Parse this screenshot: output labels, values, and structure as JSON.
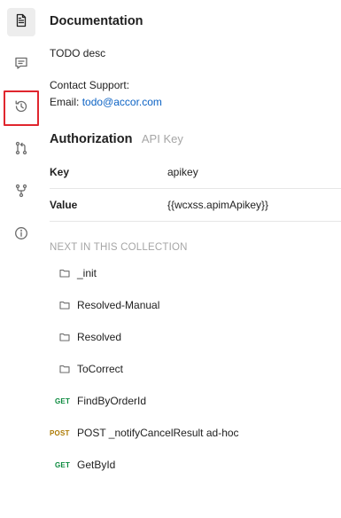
{
  "rail": {
    "items": [
      {
        "name": "documentation",
        "icon": "document-icon",
        "active": true
      },
      {
        "name": "comments",
        "icon": "comment-icon",
        "active": false
      },
      {
        "name": "history",
        "icon": "history-icon",
        "active": false,
        "highlighted": true
      },
      {
        "name": "pull-requests",
        "icon": "pull-request-icon",
        "active": false
      },
      {
        "name": "forks",
        "icon": "fork-icon",
        "active": false
      },
      {
        "name": "info",
        "icon": "info-icon",
        "active": false
      }
    ]
  },
  "documentation": {
    "title": "Documentation",
    "description": "TODO desc",
    "contact_label": "Contact Support:",
    "email_label": "Email:",
    "email_value": "todo@accor.com"
  },
  "authorization": {
    "title": "Authorization",
    "type": "API Key",
    "rows": [
      {
        "key": "Key",
        "value": "apikey"
      },
      {
        "key": "Value",
        "value": "{{wcxss.apimApikey}}"
      }
    ]
  },
  "next_in_collection": {
    "heading": "NEXT IN THIS COLLECTION",
    "items": [
      {
        "kind": "folder",
        "label": "_init",
        "icon": "folder-icon"
      },
      {
        "kind": "folder",
        "label": "Resolved-Manual",
        "icon": "folder-icon"
      },
      {
        "kind": "folder",
        "label": "Resolved",
        "icon": "folder-icon"
      },
      {
        "kind": "folder",
        "label": "ToCorrect",
        "icon": "folder-icon"
      },
      {
        "kind": "request",
        "method": "GET",
        "label": "FindByOrderId"
      },
      {
        "kind": "request",
        "method": "POST",
        "label": "POST _notifyCancelResult ad-hoc"
      },
      {
        "kind": "request",
        "method": "GET",
        "label": "GetById"
      }
    ]
  },
  "colors": {
    "link": "#0b62c4",
    "get_method": "#0b8a3e",
    "post_method": "#ad7a03",
    "highlight_border": "#e0262e",
    "muted_text": "#a6a6a6"
  }
}
